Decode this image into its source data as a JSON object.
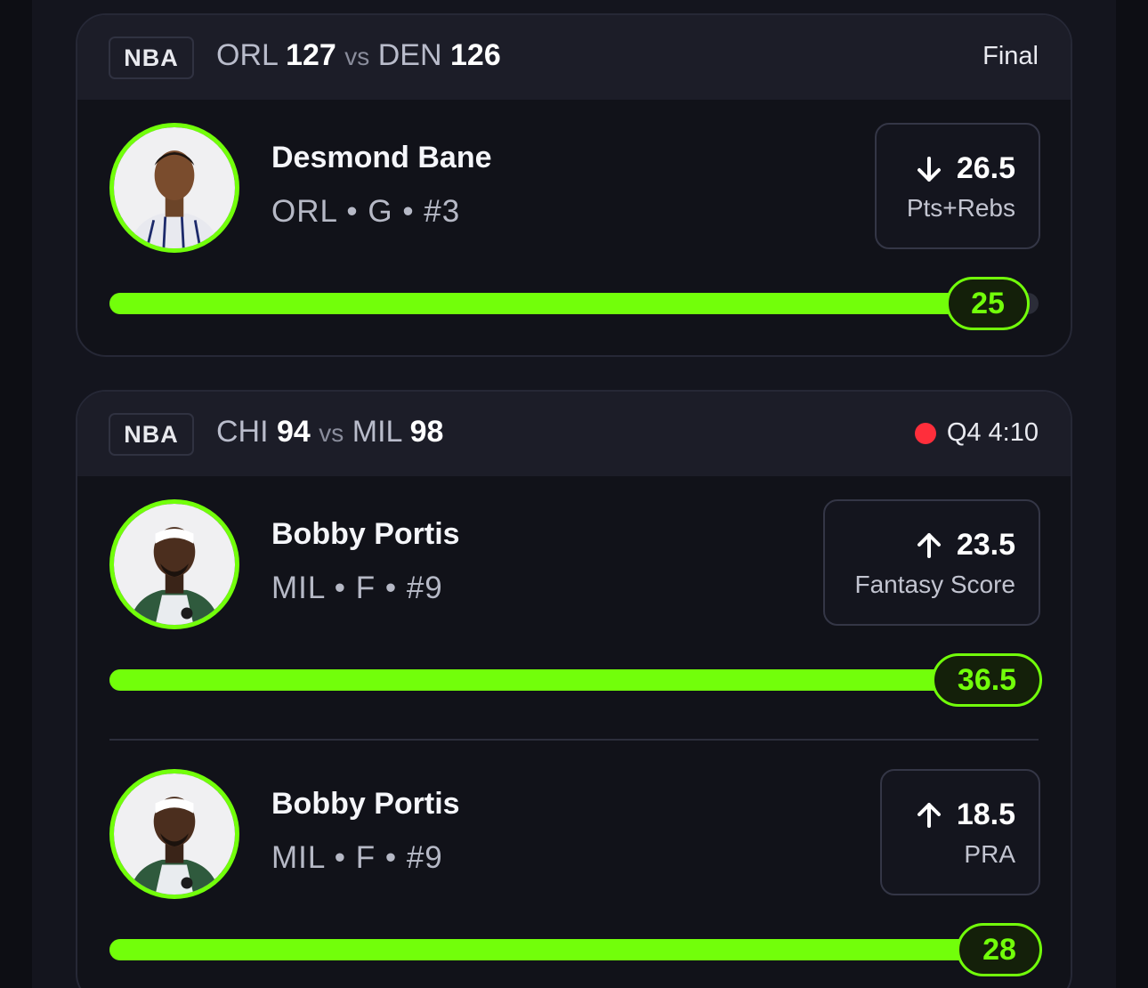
{
  "cards": [
    {
      "league": "NBA",
      "away_team": "ORL",
      "away_score": "127",
      "vs": "vs",
      "home_team": "DEN",
      "home_score": "126",
      "status": "Final",
      "picks": [
        {
          "player": "Desmond Bane",
          "meta": "ORL • G • #3",
          "direction": "down",
          "line": "26.5",
          "stat": "Pts+Rebs",
          "current": "25",
          "progress": 0.94
        }
      ]
    },
    {
      "league": "NBA",
      "away_team": "CHI",
      "away_score": "94",
      "vs": "vs",
      "home_team": "MIL",
      "home_score": "98",
      "status": "Q4 4:10",
      "live": true,
      "picks": [
        {
          "player": "Bobby Portis",
          "meta": "MIL • F • #9",
          "direction": "up",
          "line": "23.5",
          "stat": "Fantasy Score",
          "current": "36.5",
          "progress": 1.0
        },
        {
          "player": "Bobby Portis",
          "meta": "MIL • F • #9",
          "direction": "up",
          "line": "18.5",
          "stat": "PRA",
          "current": "28",
          "progress": 1.0
        }
      ]
    }
  ],
  "colors": {
    "accent": "#72ff0a",
    "live": "#ff2e3b"
  },
  "icons": {
    "down": "arrow-down-icon",
    "up": "arrow-up-icon"
  }
}
